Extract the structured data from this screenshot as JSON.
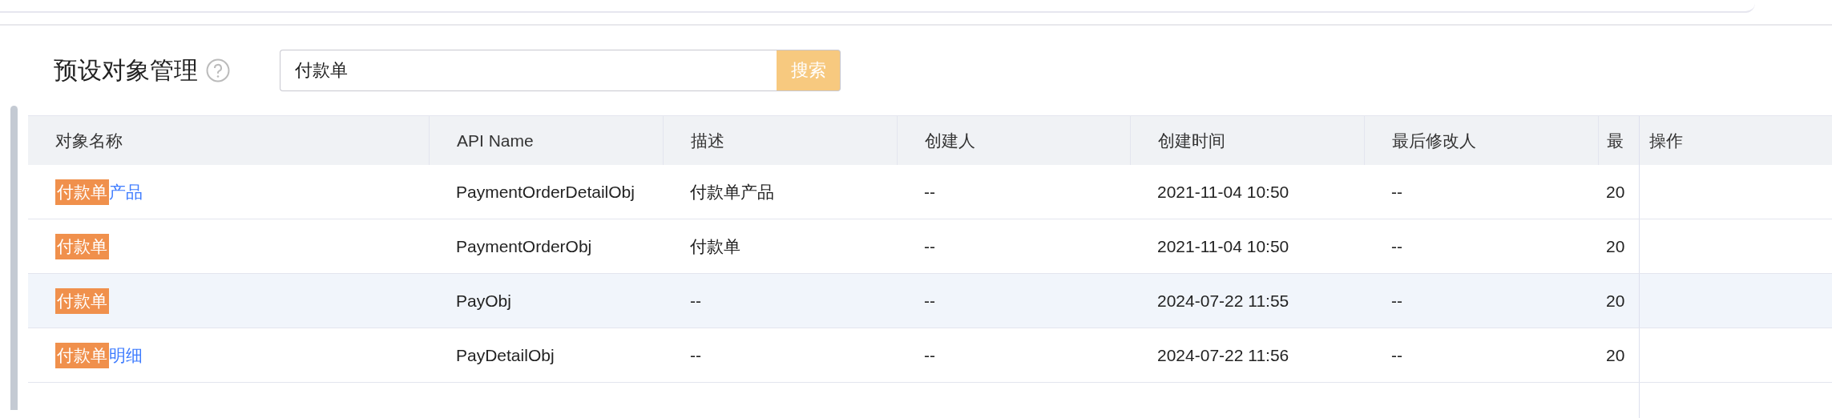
{
  "page": {
    "title": "预设对象管理",
    "help_icon": true
  },
  "search": {
    "value": "付款单",
    "button": "搜索"
  },
  "table": {
    "columns": [
      "对象名称",
      "API Name",
      "描述",
      "创建人",
      "创建时间",
      "最后修改人",
      "最",
      "操作"
    ],
    "rows": [
      {
        "highlighted": false,
        "cells": [
          {
            "match": "付款单",
            "rest": "产品"
          },
          "PaymentOrderDetailObj",
          "付款单产品",
          "--",
          "2021-11-04 10:50",
          "--",
          "20"
        ]
      },
      {
        "highlighted": false,
        "cells": [
          {
            "match": "付款单"
          },
          "PaymentOrderObj",
          "付款单",
          "--",
          "2021-11-04 10:50",
          "--",
          "20"
        ]
      },
      {
        "highlighted": true,
        "cells": [
          {
            "match": "付款单"
          },
          "PayObj",
          "--",
          "--",
          "2024-07-22 11:55",
          "--",
          "20"
        ]
      },
      {
        "highlighted": false,
        "cells": [
          {
            "match": "付款单",
            "rest": "明细"
          },
          "PayDetailObj",
          "--",
          "--",
          "2024-07-22 11:56",
          "--",
          "20"
        ]
      }
    ]
  }
}
